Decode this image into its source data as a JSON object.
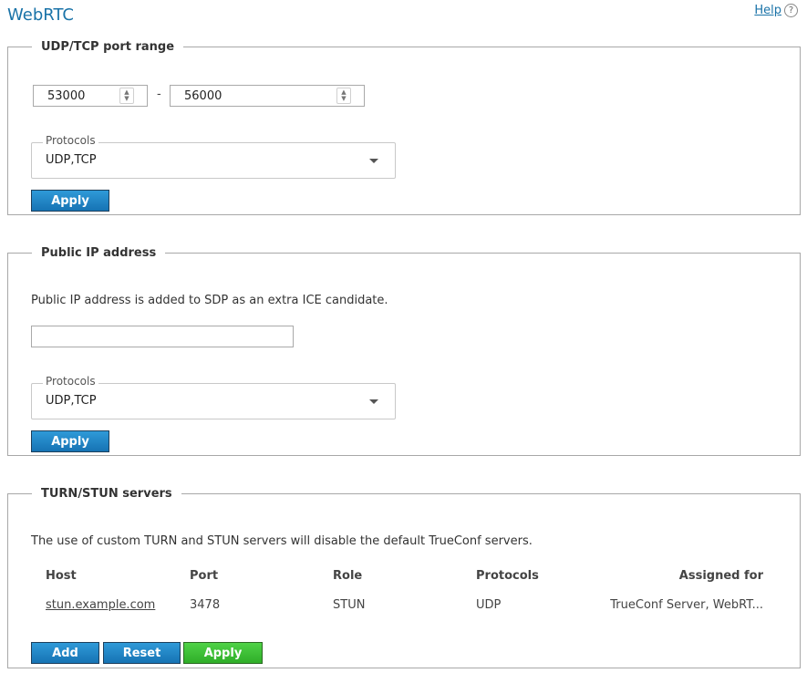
{
  "page": {
    "title": "WebRTC",
    "help_label": "Help",
    "help_icon_glyph": "?"
  },
  "port_range": {
    "legend": "UDP/TCP port range",
    "from_value": "53000",
    "separator": "-",
    "to_value": "56000",
    "protocols_label": "Protocols",
    "protocols_value": "UDP,TCP",
    "apply_label": "Apply"
  },
  "public_ip": {
    "legend": "Public IP address",
    "description": "Public IP address is added to SDP as an extra ICE candidate.",
    "ip_value": "",
    "protocols_label": "Protocols",
    "protocols_value": "UDP,TCP",
    "apply_label": "Apply"
  },
  "turn_stun": {
    "legend": "TURN/STUN servers",
    "description": "The use of custom TURN and STUN servers will disable the default TrueConf servers.",
    "columns": {
      "host": "Host",
      "port": "Port",
      "role": "Role",
      "protocols": "Protocols",
      "assigned": "Assigned for"
    },
    "rows": [
      {
        "host": "stun.example.com",
        "port": "3478",
        "role": "STUN",
        "protocols": "UDP",
        "assigned": "TrueConf Server, WebRT..."
      }
    ],
    "add_label": "Add",
    "reset_label": "Reset",
    "apply_label": "Apply"
  },
  "colors": {
    "title": "#1a73a8",
    "button_blue": "#1673b4",
    "button_green": "#2fae28"
  }
}
